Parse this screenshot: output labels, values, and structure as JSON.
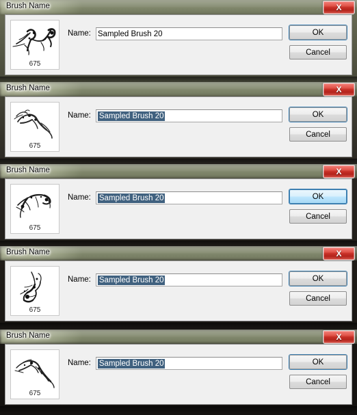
{
  "window": {
    "title": "Brush Name",
    "close_label": "X",
    "close_icon": "close-icon"
  },
  "form": {
    "name_label": "Name:",
    "name_value": "Sampled Brush 20",
    "name_placeholder": "Sampled Brush 20"
  },
  "buttons": {
    "ok_label": "OK",
    "cancel_label": "Cancel"
  },
  "thumbnail": {
    "size_label": "675"
  },
  "colors": {
    "selection": "#40617f",
    "focus_ring": "#3c7fb1",
    "close_button": "#c62f26",
    "client_bg": "#f0f0f0",
    "frame_glass": "#cfcab0"
  },
  "dialogs": [
    {
      "index": 1,
      "title": "Brush Name",
      "name_value": "Sampled Brush 20",
      "name_selected": false,
      "ok_state": "default",
      "cancel_state": "normal",
      "thumb_label": "675",
      "thumb_shape": "brush-splatter-1"
    },
    {
      "index": 2,
      "title": "Brush Name",
      "name_value": "Sampled Brush 20",
      "name_selected": true,
      "ok_state": "default",
      "cancel_state": "normal",
      "thumb_label": "675",
      "thumb_shape": "brush-splatter-2"
    },
    {
      "index": 3,
      "title": "Brush Name",
      "name_value": "Sampled Brush 20",
      "name_selected": true,
      "ok_state": "hover",
      "cancel_state": "normal",
      "thumb_label": "675",
      "thumb_shape": "brush-splatter-3"
    },
    {
      "index": 4,
      "title": "Brush Name",
      "name_value": "Sampled Brush 20",
      "name_selected": true,
      "ok_state": "default",
      "cancel_state": "normal",
      "thumb_label": "675",
      "thumb_shape": "brush-splatter-4"
    },
    {
      "index": 5,
      "title": "Brush Name",
      "name_value": "Sampled Brush 20",
      "name_selected": true,
      "ok_state": "default",
      "cancel_state": "normal",
      "thumb_label": "675",
      "thumb_shape": "brush-splatter-5"
    }
  ]
}
